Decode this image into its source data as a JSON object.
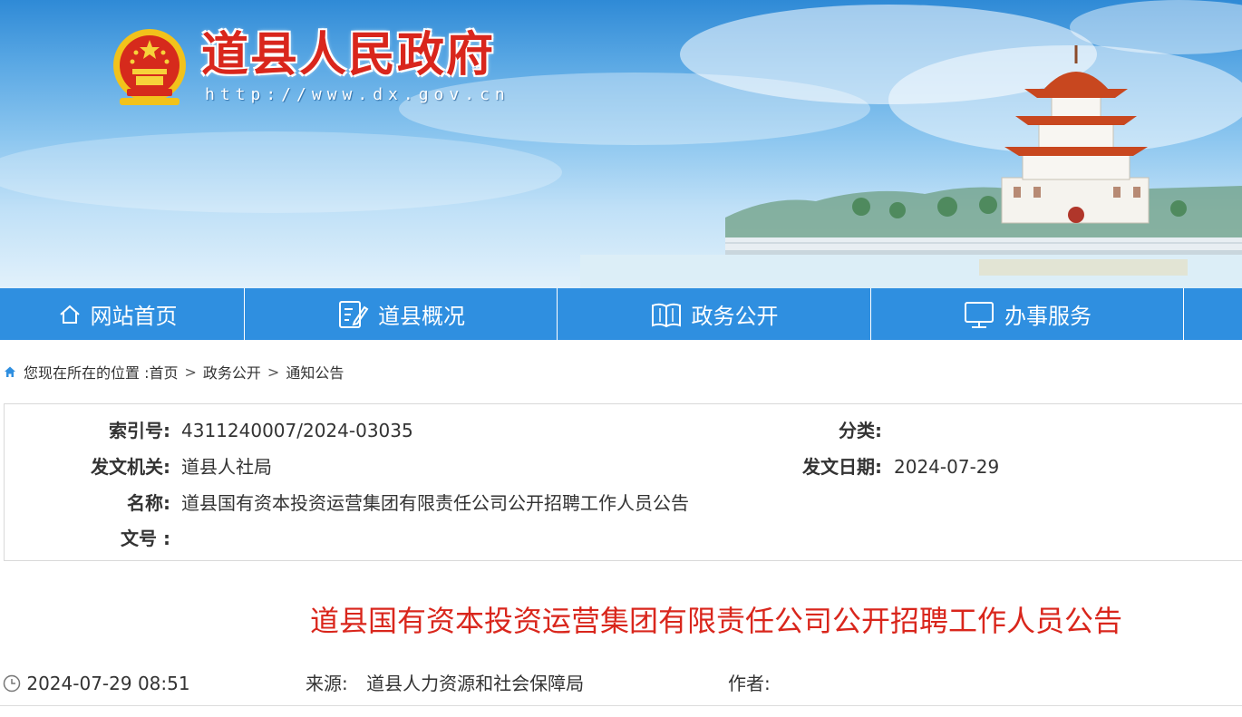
{
  "header": {
    "site_title": "道县人民政府",
    "site_url": "http://www.dx.gov.cn"
  },
  "nav": {
    "items": [
      {
        "label": "网站首页",
        "icon": "home-icon"
      },
      {
        "label": "道县概况",
        "icon": "document-edit-icon"
      },
      {
        "label": "政务公开",
        "icon": "open-book-icon"
      },
      {
        "label": "办事服务",
        "icon": "monitor-icon"
      }
    ]
  },
  "breadcrumb": {
    "prefix": "您现在所在的位置 : ",
    "items": [
      "首页",
      "政务公开",
      "通知公告"
    ],
    "separator": ">"
  },
  "meta": {
    "index_label": "索引号:",
    "index_value": "4311240007/2024-03035",
    "category_label": "分类:",
    "category_value": "",
    "issuer_label": "发文机关:",
    "issuer_value": "道县人社局",
    "date_label": "发文日期:",
    "date_value": "2024-07-29",
    "name_label": "名称:",
    "name_value": "道县国有资本投资运营集团有限责任公司公开招聘工作人员公告",
    "docno_label": "文号 :",
    "docno_value": ""
  },
  "article": {
    "title": "道县国有资本投资运营集团有限责任公司公开招聘工作人员公告",
    "datetime": "2024-07-29 08:51",
    "source_label": "来源:",
    "source_value": "道县人力资源和社会保障局",
    "author_label": "作者:",
    "author_value": ""
  },
  "colors": {
    "nav_bg": "#2f8fe0",
    "title_red": "#d9261c",
    "text": "#333333"
  }
}
